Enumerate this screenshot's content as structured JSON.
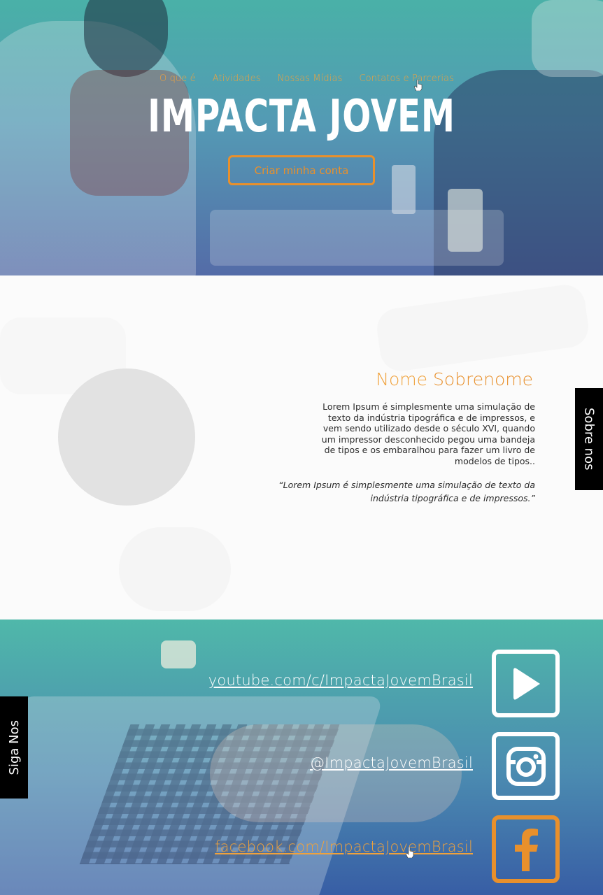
{
  "nav": {
    "items": [
      "O que é",
      "Atividades",
      "Nossas Mídias",
      "Contatos e Parcerias"
    ]
  },
  "hero": {
    "title": "IMPACTA JOVEM",
    "cta_label": "Criar minha conta"
  },
  "about": {
    "first_name": "Nome",
    "last_name": "Sobrenome",
    "bio": "Lorem Ipsum é simplesmente uma simulação de texto da indústria tipográfica e de impressos, e vem sendo utilizado desde o século XVI, quando um impressor desconhecido pegou uma bandeja de tipos e os embaralhou para fazer um livro de modelos de tipos..",
    "quote": "“Lorem Ipsum é simplesmente uma simulação de texto da indústria tipográfica e de impressos.”",
    "side_tab": "Sobre nos"
  },
  "social": {
    "side_tab": "Siga Nos",
    "links": [
      {
        "label": "youtube.com/c/ImpactaJovemBrasil",
        "icon": "youtube-play-icon"
      },
      {
        "label": "@ImpactaJovemBrasil",
        "icon": "instagram-icon"
      },
      {
        "label": "facebook.com/ImpactaJovemBrasil",
        "icon": "facebook-icon"
      }
    ]
  },
  "colors": {
    "accent": "#e8902c",
    "hero_teal": "#3aaaa0",
    "hero_blue": "#465fa0",
    "side_tab": "#000000"
  }
}
